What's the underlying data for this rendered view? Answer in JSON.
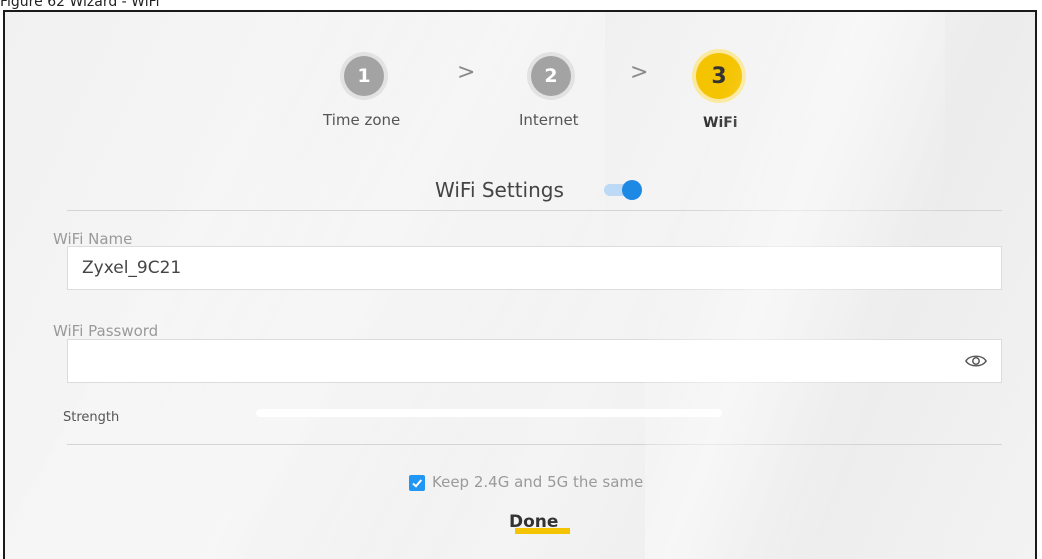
{
  "caption": "Figure 62   Wizard - WiFi",
  "steps": [
    {
      "number": "1",
      "label": "Time zone",
      "state": "done"
    },
    {
      "number": "2",
      "label": "Internet",
      "state": "done"
    },
    {
      "number": "3",
      "label": "WiFi",
      "state": "active"
    }
  ],
  "step_separator": ">",
  "wifi_settings": {
    "title": "WiFi Settings",
    "toggle_on": true
  },
  "wifi_name": {
    "label": "WiFi Name",
    "value": "Zyxel_9C21"
  },
  "wifi_password": {
    "label": "WiFi Password",
    "value": ""
  },
  "strength": {
    "label": "Strength",
    "value": 0
  },
  "keep_same": {
    "label": "Keep 2.4G and 5G the same",
    "checked": true
  },
  "done_label": "Done",
  "colors": {
    "accent_yellow": "#f5c400",
    "toggle_blue": "#1e88e5",
    "checkbox_blue": "#2196f3",
    "completed_step_gray": "#a3a3a3"
  },
  "icons": {
    "password_visibility": "eye-icon",
    "checkbox_mark": "checkmark-icon"
  }
}
